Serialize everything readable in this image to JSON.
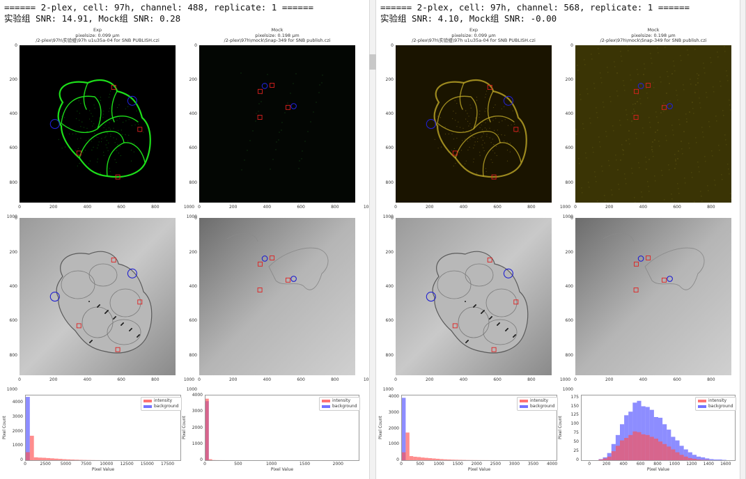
{
  "colors": {
    "exp_green": "#1ddf1a",
    "exp_yellow": "#c8b02a",
    "roi_intensity": "#e02020",
    "roi_background": "#2020d0",
    "hist_intensity": "#ff5050",
    "hist_background": "#5050ff"
  },
  "icons": {
    "intensity_roi": "red-square",
    "background_roi": "blue-circle"
  },
  "panels": [
    {
      "header_line1": "====== 2-plex, cell: 97h, channel: 488, replicate: 1 ======",
      "header_line2": "实验组 SNR: 14.91, Mock组 SNR: 0.28",
      "fluor": "green",
      "exp_title": [
        "Exp",
        "pixelsize: 0.099 μm",
        "/2-plex\\97h\\实验组\\97h u1u35a-04 for SNB PUBLISH.czi"
      ],
      "mock_title": [
        "Mock",
        "pixelsize: 0.198 μm",
        "/2-plex\\97h\\mock\\Snap-349 for SNB publish.czi"
      ]
    },
    {
      "header_line1": "====== 2-plex, cell: 97h, channel: 568, replicate: 1 ======",
      "header_line2": "实验组 SNR: 4.10, Mock组 SNR: -0.00",
      "fluor": "yellow",
      "exp_title": [
        "Exp",
        "pixelsize: 0.099 μm",
        "/2-plex\\97h\\实验组\\97h u1u35a-04 for SNB PUBLISH.czi"
      ],
      "mock_title": [
        "Mock",
        "pixelsize: 0.198 μm",
        "/2-plex\\97h\\mock\\Snap-349 for SNB publish.czi"
      ]
    }
  ],
  "image_axes": {
    "yticks": [
      "0",
      "200",
      "400",
      "600",
      "800",
      "1000"
    ],
    "xticks": [
      "0",
      "200",
      "400",
      "600",
      "800",
      "1000"
    ]
  },
  "legend": {
    "intensity": "intensity",
    "background": "background"
  },
  "chart_data": [
    {
      "type": "bar",
      "title": "",
      "panel": "488-exp",
      "xlabel": "Pixel Value",
      "ylabel": "Pixel Count",
      "xlim": [
        0,
        19000
      ],
      "ylim": [
        0,
        4500
      ],
      "xticks": [
        0,
        2500,
        5000,
        7500,
        10000,
        12500,
        15000,
        17500
      ],
      "xtick_labels": [
        "0",
        "2500",
        "5000",
        "7500",
        "10000",
        "12500",
        "15000",
        "17500"
      ],
      "yticks": [
        0,
        1000,
        2000,
        3000,
        4000
      ],
      "series": [
        {
          "name": "intensity",
          "bin_start": 0,
          "bin_width": 500,
          "values": [
            560,
            1700,
            200,
            180,
            170,
            150,
            130,
            110,
            90,
            70,
            55,
            45,
            35,
            25,
            18,
            12,
            8,
            5,
            3,
            2,
            1
          ]
        },
        {
          "name": "background",
          "bin_start": 0,
          "bin_width": 500,
          "values": [
            4400,
            0
          ]
        }
      ]
    },
    {
      "type": "bar",
      "title": "",
      "panel": "488-mock",
      "xlabel": "Pixel Value",
      "ylabel": "Pixel Count",
      "xlim": [
        0,
        2300
      ],
      "ylim": [
        0,
        4000
      ],
      "xticks": [
        0,
        500,
        1000,
        1500,
        2000
      ],
      "xtick_labels": [
        "0",
        "500",
        "1000",
        "1500",
        "2000"
      ],
      "yticks": [
        0,
        1000,
        2000,
        3000,
        4000
      ],
      "series": [
        {
          "name": "intensity",
          "bin_start": 0,
          "bin_width": 50,
          "values": [
            3800,
            60,
            10,
            5,
            3,
            2,
            1
          ]
        },
        {
          "name": "background",
          "bin_start": 0,
          "bin_width": 50,
          "values": [
            3650,
            0
          ]
        }
      ]
    },
    {
      "type": "bar",
      "title": "",
      "panel": "568-exp",
      "xlabel": "Pixel Value",
      "ylabel": "Pixel Count",
      "xlim": [
        0,
        4100
      ],
      "ylim": [
        0,
        4100
      ],
      "xticks": [
        0,
        500,
        1000,
        1500,
        2000,
        2500,
        3000,
        3500,
        4000
      ],
      "xtick_labels": [
        "0",
        "500",
        "1000",
        "1500",
        "2000",
        "2500",
        "3000",
        "3500",
        "4000"
      ],
      "yticks": [
        0,
        1000,
        2000,
        3000,
        4000
      ],
      "series": [
        {
          "name": "intensity",
          "bin_start": 0,
          "bin_width": 100,
          "values": [
            500,
            1750,
            260,
            220,
            200,
            170,
            150,
            130,
            110,
            90,
            70,
            55,
            45,
            35,
            28,
            22,
            17,
            12,
            9,
            7,
            5,
            4,
            3,
            2,
            2,
            1
          ]
        },
        {
          "name": "background",
          "bin_start": 0,
          "bin_width": 100,
          "values": [
            3950,
            0
          ]
        }
      ]
    },
    {
      "type": "bar",
      "title": "",
      "panel": "568-mock",
      "xlabel": "Pixel Value",
      "ylabel": "Pixel Count",
      "xlim": [
        -100,
        1700
      ],
      "ylim": [
        0,
        180
      ],
      "xticks": [
        0,
        200,
        400,
        600,
        800,
        1000,
        1200,
        1400,
        1600
      ],
      "xtick_labels": [
        "0",
        "200",
        "400",
        "600",
        "800",
        "1000",
        "1200",
        "1400",
        "1600"
      ],
      "yticks": [
        0,
        25,
        50,
        75,
        100,
        125,
        150,
        175
      ],
      "series": [
        {
          "name": "intensity",
          "bin_start": 100,
          "bin_width": 50,
          "values": [
            2,
            5,
            10,
            25,
            40,
            55,
            62,
            70,
            80,
            78,
            72,
            70,
            65,
            60,
            52,
            45,
            38,
            30,
            22,
            15,
            10,
            6,
            4,
            2,
            1,
            1,
            0,
            0,
            0,
            0
          ]
        },
        {
          "name": "background",
          "bin_start": 100,
          "bin_width": 50,
          "values": [
            3,
            8,
            20,
            45,
            70,
            100,
            125,
            135,
            160,
            165,
            150,
            148,
            140,
            120,
            118,
            100,
            85,
            65,
            55,
            40,
            30,
            22,
            15,
            10,
            8,
            5,
            3,
            2,
            2,
            1
          ]
        }
      ]
    }
  ]
}
